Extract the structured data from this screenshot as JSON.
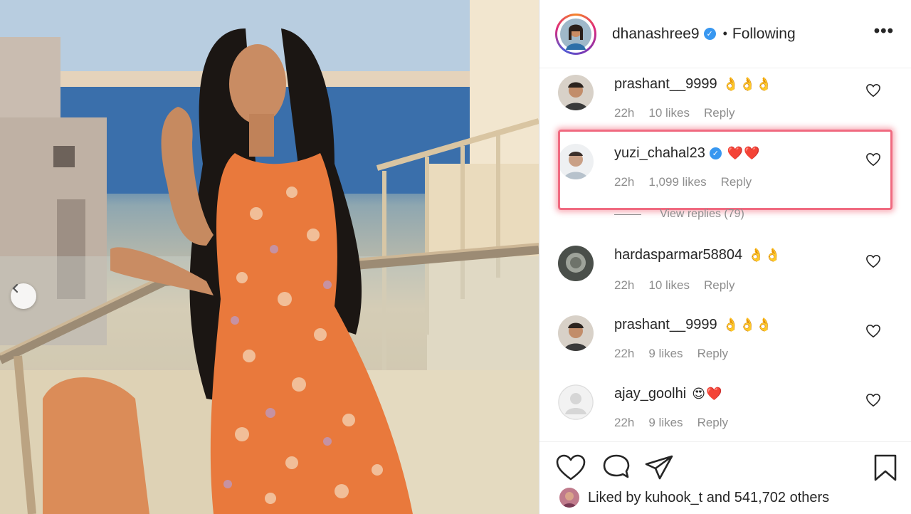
{
  "post": {
    "author": "dhanashree9",
    "separator": "•",
    "follow_status": "Following",
    "more_icon": "more-options-icon"
  },
  "comments": [
    {
      "username": "prashant__9999",
      "text": "👌👌👌",
      "age": "22h",
      "likes": "10 likes",
      "reply": "Reply"
    },
    {
      "username": "yuzi_chahal23",
      "verified": true,
      "text": "❤️❤️",
      "age": "22h",
      "likes": "1,099 likes",
      "reply": "Reply",
      "highlighted": true
    },
    {
      "username": "hardasparmar58804",
      "text": "👌👌",
      "age": "22h",
      "likes": "10 likes",
      "reply": "Reply"
    },
    {
      "username": "prashant__9999",
      "text": "👌👌👌",
      "age": "22h",
      "likes": "9 likes",
      "reply": "Reply"
    },
    {
      "username": "ajay_goolhi",
      "text": "😍❤️",
      "age": "22h",
      "likes": "9 likes",
      "reply": "Reply"
    }
  ],
  "view_replies": "View replies (79)",
  "liked_by": {
    "prefix": "Liked by",
    "user": "kuhook_t",
    "middle": "and",
    "others": "541,702 others"
  },
  "colors": {
    "accent_verified": "#3897f0",
    "highlight_border": "#f06a80",
    "muted_text": "#8e8e8e"
  }
}
